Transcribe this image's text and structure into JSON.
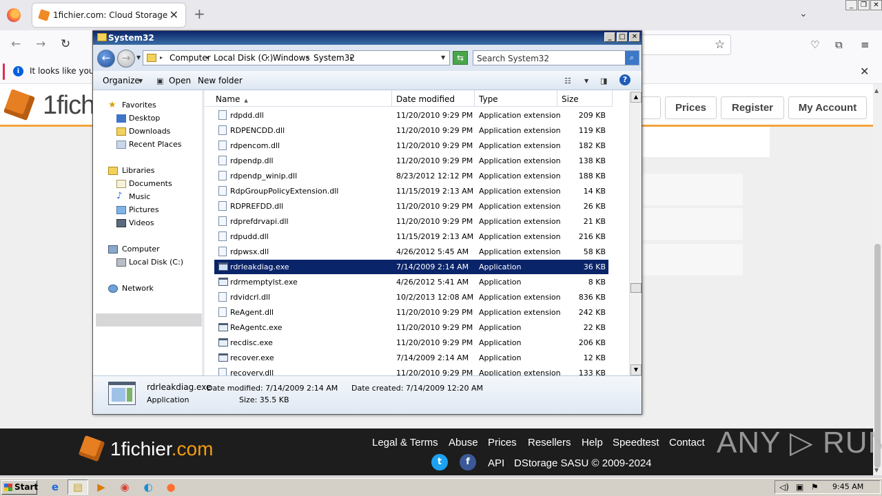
{
  "browser": {
    "tab_title": "1fichier.com: Cloud Storage",
    "tab_close": "✕",
    "new_tab": "+",
    "notification": "It looks like you ha",
    "notification_close": "✕"
  },
  "site": {
    "logo_text": "1fich",
    "buttons": [
      {
        "label": ""
      },
      {
        "label": "Prices"
      },
      {
        "label": "Register"
      },
      {
        "label": "My Account"
      }
    ],
    "footer": {
      "logo_main": "1fichier",
      "logo_tld": ".com",
      "links": [
        "Legal & Terms",
        "Abuse",
        "Prices",
        "Resellers",
        "Help",
        "Speedtest",
        "Contact"
      ],
      "api": "API",
      "copyright": "DStorage SASU © 2009-2024",
      "twitter": "t",
      "facebook": "f"
    },
    "watermark": "ANY ▷ RUN"
  },
  "explorer": {
    "title": "System32",
    "breadcrumb": [
      "Computer",
      "Local Disk (C:)",
      "Windows",
      "System32"
    ],
    "search_placeholder": "Search System32",
    "commands": {
      "organize": "Organize",
      "open": "Open",
      "new_folder": "New folder"
    },
    "nav": {
      "favorites": "Favorites",
      "desktop": "Desktop",
      "downloads": "Downloads",
      "recent": "Recent Places",
      "libraries": "Libraries",
      "documents": "Documents",
      "music": "Music",
      "pictures": "Pictures",
      "videos": "Videos",
      "computer": "Computer",
      "local_disk": "Local Disk (C:)",
      "network": "Network"
    },
    "columns": {
      "name": "Name",
      "date": "Date modified",
      "type": "Type",
      "size": "Size"
    },
    "files": [
      {
        "name": "rdpdd.dll",
        "date": "11/20/2010 9:29 PM",
        "type": "Application extension",
        "size": "209 KB",
        "kind": "dll"
      },
      {
        "name": "RDPENCDD.dll",
        "date": "11/20/2010 9:29 PM",
        "type": "Application extension",
        "size": "119 KB",
        "kind": "dll"
      },
      {
        "name": "rdpencom.dll",
        "date": "11/20/2010 9:29 PM",
        "type": "Application extension",
        "size": "182 KB",
        "kind": "dll"
      },
      {
        "name": "rdpendp.dll",
        "date": "11/20/2010 9:29 PM",
        "type": "Application extension",
        "size": "138 KB",
        "kind": "dll"
      },
      {
        "name": "rdpendp_winip.dll",
        "date": "8/23/2012 12:12 PM",
        "type": "Application extension",
        "size": "188 KB",
        "kind": "dll"
      },
      {
        "name": "RdpGroupPolicyExtension.dll",
        "date": "11/15/2019 2:13 AM",
        "type": "Application extension",
        "size": "14 KB",
        "kind": "dll"
      },
      {
        "name": "RDPREFDD.dll",
        "date": "11/20/2010 9:29 PM",
        "type": "Application extension",
        "size": "26 KB",
        "kind": "dll"
      },
      {
        "name": "rdprefdrvapi.dll",
        "date": "11/20/2010 9:29 PM",
        "type": "Application extension",
        "size": "21 KB",
        "kind": "dll"
      },
      {
        "name": "rdpudd.dll",
        "date": "11/15/2019 2:13 AM",
        "type": "Application extension",
        "size": "216 KB",
        "kind": "dll"
      },
      {
        "name": "rdpwsx.dll",
        "date": "4/26/2012 5:45 AM",
        "type": "Application extension",
        "size": "58 KB",
        "kind": "dll"
      },
      {
        "name": "rdrleakdiag.exe",
        "date": "7/14/2009 2:14 AM",
        "type": "Application",
        "size": "36 KB",
        "kind": "exe",
        "selected": true
      },
      {
        "name": "rdrmemptylst.exe",
        "date": "4/26/2012 5:41 AM",
        "type": "Application",
        "size": "8 KB",
        "kind": "exe"
      },
      {
        "name": "rdvidcrl.dll",
        "date": "10/2/2013 12:08 AM",
        "type": "Application extension",
        "size": "836 KB",
        "kind": "dll"
      },
      {
        "name": "ReAgent.dll",
        "date": "11/20/2010 9:29 PM",
        "type": "Application extension",
        "size": "242 KB",
        "kind": "dll"
      },
      {
        "name": "ReAgentc.exe",
        "date": "11/20/2010 9:29 PM",
        "type": "Application",
        "size": "22 KB",
        "kind": "exe"
      },
      {
        "name": "recdisc.exe",
        "date": "11/20/2010 9:29 PM",
        "type": "Application",
        "size": "206 KB",
        "kind": "exe"
      },
      {
        "name": "recover.exe",
        "date": "7/14/2009 2:14 AM",
        "type": "Application",
        "size": "12 KB",
        "kind": "exe"
      },
      {
        "name": "recovery.dll",
        "date": "11/20/2010 9:29 PM",
        "type": "Application extension",
        "size": "133 KB",
        "kind": "dll"
      }
    ],
    "details": {
      "name": "rdrleakdiag.exe",
      "type": "Application",
      "date_modified": "Date modified: 7/14/2009 2:14 AM",
      "size": "Size: 35.5 KB",
      "date_created": "Date created: 7/14/2009 12:20 AM"
    }
  },
  "taskbar": {
    "start": "Start",
    "clock": "9:45 AM"
  },
  "colors": {
    "selection": "#0a246a",
    "brand_orange": "#e67e22",
    "footer_bg": "#1d1d1d"
  }
}
